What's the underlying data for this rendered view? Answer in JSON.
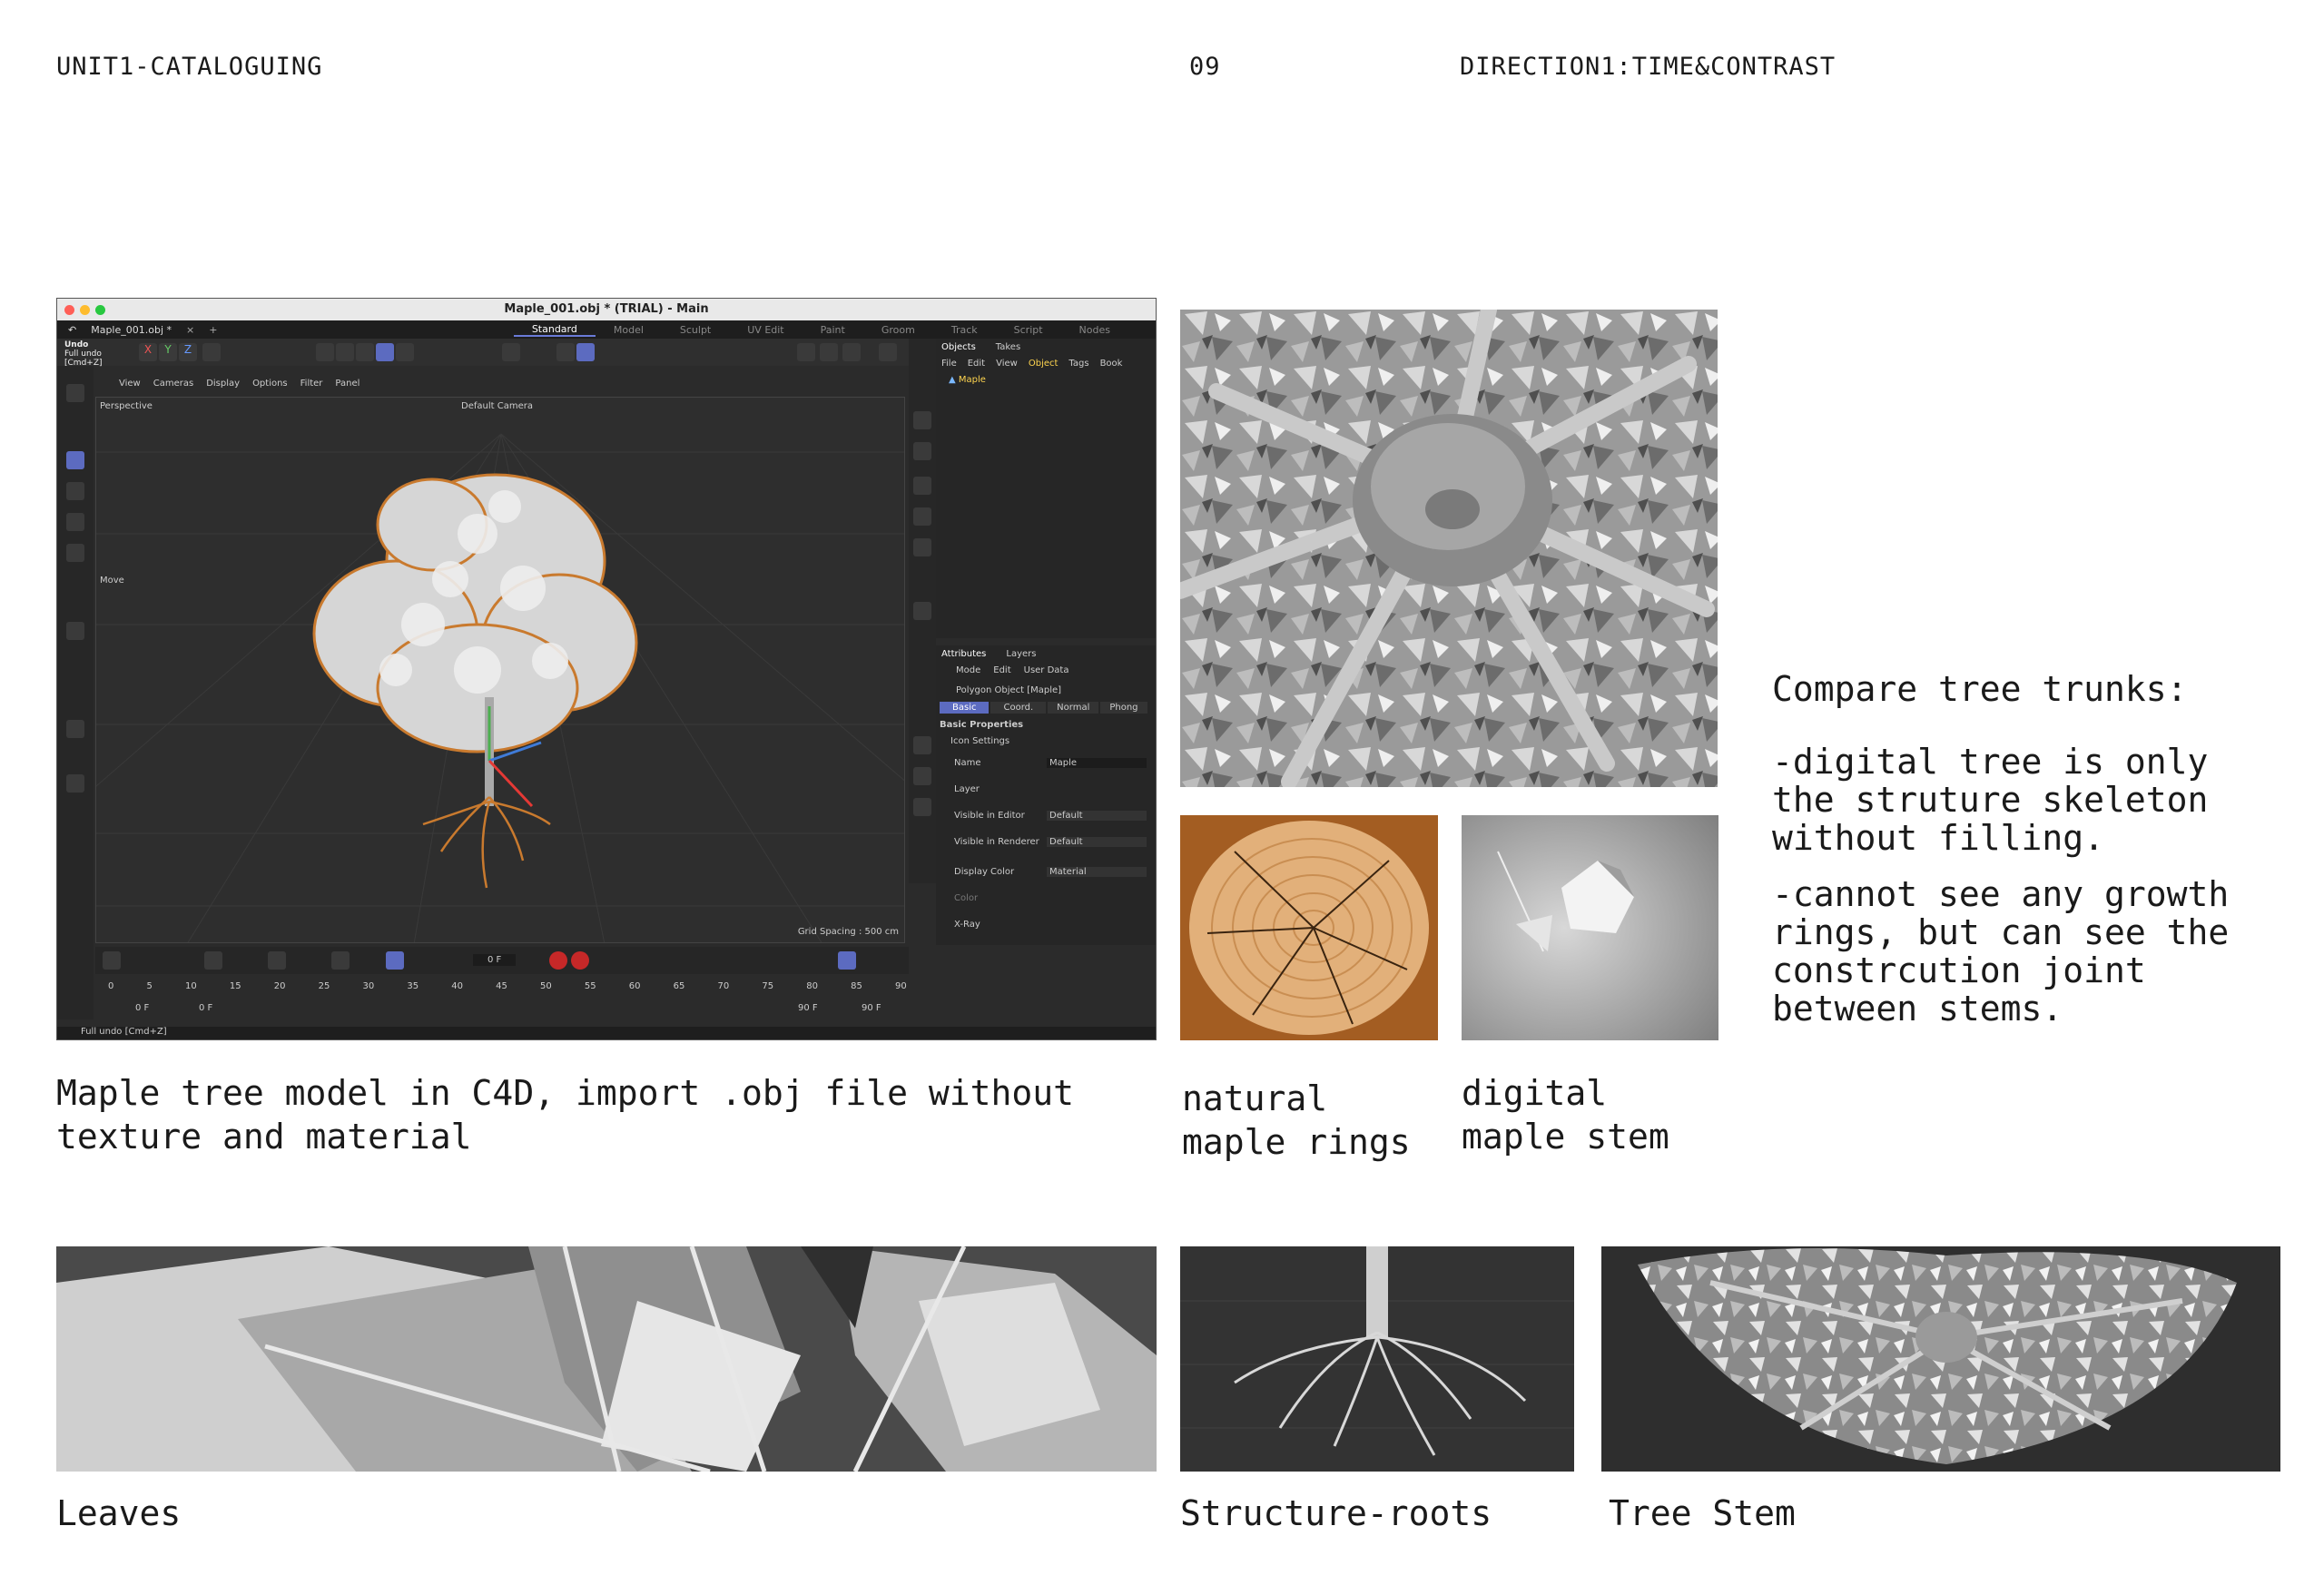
{
  "header": {
    "left": "UNIT1-CATALOGUING",
    "page": "09",
    "right": "DIRECTION1:TIME&CONTRAST"
  },
  "c4d": {
    "window_title": "Maple_001.obj * (TRIAL) - Main",
    "file_tab": "Maple_001.obj *",
    "layouts": [
      "Standard",
      "Model",
      "Sculpt",
      "UV Edit",
      "Paint",
      "Groom",
      "Track",
      "Script",
      "Nodes"
    ],
    "undo_tip": [
      "Undo",
      "Full undo",
      "[Cmd+Z]"
    ],
    "viewport_menu": [
      "View",
      "Cameras",
      "Display",
      "Options",
      "Filter",
      "Panel"
    ],
    "viewport_label": "Perspective",
    "camera_label": "Default Camera",
    "move_label": "Move",
    "grid_spacing": "Grid Spacing : 500 cm",
    "objects_tabs": [
      "Objects",
      "Takes"
    ],
    "objects_menu": [
      "File",
      "Edit",
      "View",
      "Object",
      "Tags",
      "Book"
    ],
    "object_name": "Maple",
    "attr_tabs": [
      "Attributes",
      "Layers"
    ],
    "attr_menu": [
      "Mode",
      "Edit",
      "User Data"
    ],
    "attr_object": "Polygon Object [Maple]",
    "attr_subtabs": [
      "Basic",
      "Coord.",
      "Normal",
      "Phong"
    ],
    "basic_props": "Basic Properties",
    "icon_settings": "Icon Settings",
    "props": [
      {
        "label": "Name",
        "value": "Maple"
      },
      {
        "label": "Layer",
        "value": ""
      },
      {
        "label": "Visible in Editor",
        "value": "Default"
      },
      {
        "label": "Visible in Renderer",
        "value": "Default"
      },
      {
        "label": "Display Color",
        "value": "Material"
      },
      {
        "label": "Color",
        "value": ""
      },
      {
        "label": "X-Ray",
        "value": ""
      }
    ],
    "frame_field": "0 F",
    "timeline_ticks": [
      "0",
      "5",
      "10",
      "15",
      "20",
      "25",
      "30",
      "35",
      "40",
      "45",
      "50",
      "55",
      "60",
      "65",
      "70",
      "75",
      "80",
      "85",
      "90"
    ],
    "range_start": "0 F",
    "range_start2": "0 F",
    "range_end": "90 F",
    "range_end2": "90 F",
    "status": "Full undo [Cmd+Z]",
    "colors": {
      "accent": "#5c6bc0",
      "tree_orange": "#c97a2e",
      "bg": "#2b2b2b"
    }
  },
  "captions": {
    "c4d": "Maple tree model in C4D, import .obj file without\ntexture and material",
    "natural": "natural\nmaple rings",
    "digital": "digital\nmaple stem",
    "leaves": "Leaves",
    "roots": "Structure-roots",
    "stem": "Tree Stem"
  },
  "notes": {
    "heading": "Compare tree trunks:",
    "point1": "-digital tree is only\nthe struture skeleton\nwithout filling.",
    "point2": "-cannot see any growth\nrings, but can see the\nconstrcution joint\nbetween stems."
  }
}
